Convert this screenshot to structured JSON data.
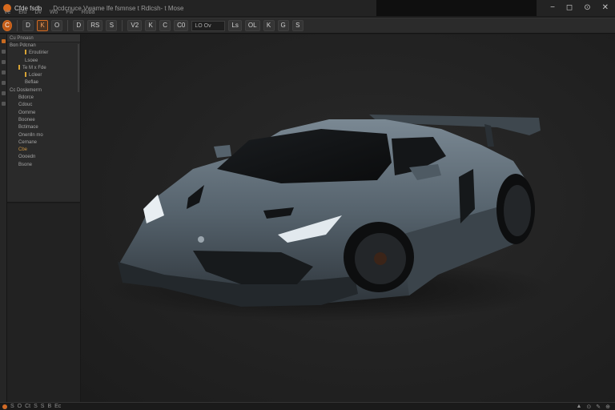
{
  "window": {
    "app_name": "Cfde fsdb",
    "doc_title": "Dcdcnuce Vwame lfe fsmnse t Rdlcsh- t Mose",
    "controls": [
      "−",
      "◻",
      "⊙",
      "✕"
    ]
  },
  "menu": [
    "Ve",
    "Eiu",
    "Dv",
    "Wo",
    "Fw",
    "Roba"
  ],
  "toolbar": {
    "buttons": [
      "C",
      "D",
      "K",
      "O",
      "D",
      "RS",
      "S",
      "V2",
      "K",
      "C",
      "C0",
      "Ls",
      "OL",
      "K",
      "G",
      "S"
    ],
    "field_value": "LO Ov"
  },
  "outliner": {
    "header": "Cu  Pnoasn",
    "rows": [
      {
        "text": "Bon  Pdcnan",
        "level": 1,
        "mark": false,
        "orange": false
      },
      {
        "text": "Eroutirier",
        "level": 3,
        "mark": true,
        "orange": false
      },
      {
        "text": "Lsoee",
        "level": 3,
        "mark": false,
        "orange": false
      },
      {
        "text": "Te M x Fde",
        "level": 2,
        "mark": true,
        "orange": false
      },
      {
        "text": "Lcleer",
        "level": 3,
        "mark": true,
        "orange": false
      },
      {
        "text": "Beflae",
        "level": 3,
        "mark": false,
        "orange": false
      },
      {
        "text": "Cc  Doslemerrn",
        "level": 1,
        "mark": false,
        "orange": false
      },
      {
        "text": "Bdorce",
        "level": 2,
        "mark": false,
        "orange": false
      },
      {
        "text": "Cdouc",
        "level": 2,
        "mark": false,
        "orange": false
      },
      {
        "text": "Oomme",
        "level": 2,
        "mark": false,
        "orange": false
      },
      {
        "text": "Boonee",
        "level": 2,
        "mark": false,
        "orange": false
      },
      {
        "text": "Bctimace",
        "level": 2,
        "mark": false,
        "orange": false
      },
      {
        "text": "Onenlln mo",
        "level": 2,
        "mark": false,
        "orange": false
      },
      {
        "text": "Cernane",
        "level": 2,
        "mark": false,
        "orange": false
      },
      {
        "text": "Cbe",
        "level": 2,
        "mark": false,
        "orange": true
      },
      {
        "text": "Oooedn",
        "level": 2,
        "mark": false,
        "orange": false
      },
      {
        "text": "Bsone",
        "level": 2,
        "mark": false,
        "orange": false
      }
    ]
  },
  "statusbar": {
    "items": [
      "S",
      "O",
      "Ct",
      "S",
      "S",
      "B",
      "Ec"
    ],
    "right_items": [
      "▲",
      "⊙",
      "✎",
      "⊕"
    ]
  },
  "colors": {
    "accent": "#d36b22",
    "background": "#1c1c1c",
    "panel": "#2a2a2a",
    "car_body": "#5b6973"
  },
  "icons": {
    "app": "app-logo-icon",
    "outliner_marker": "object-marker-icon"
  }
}
